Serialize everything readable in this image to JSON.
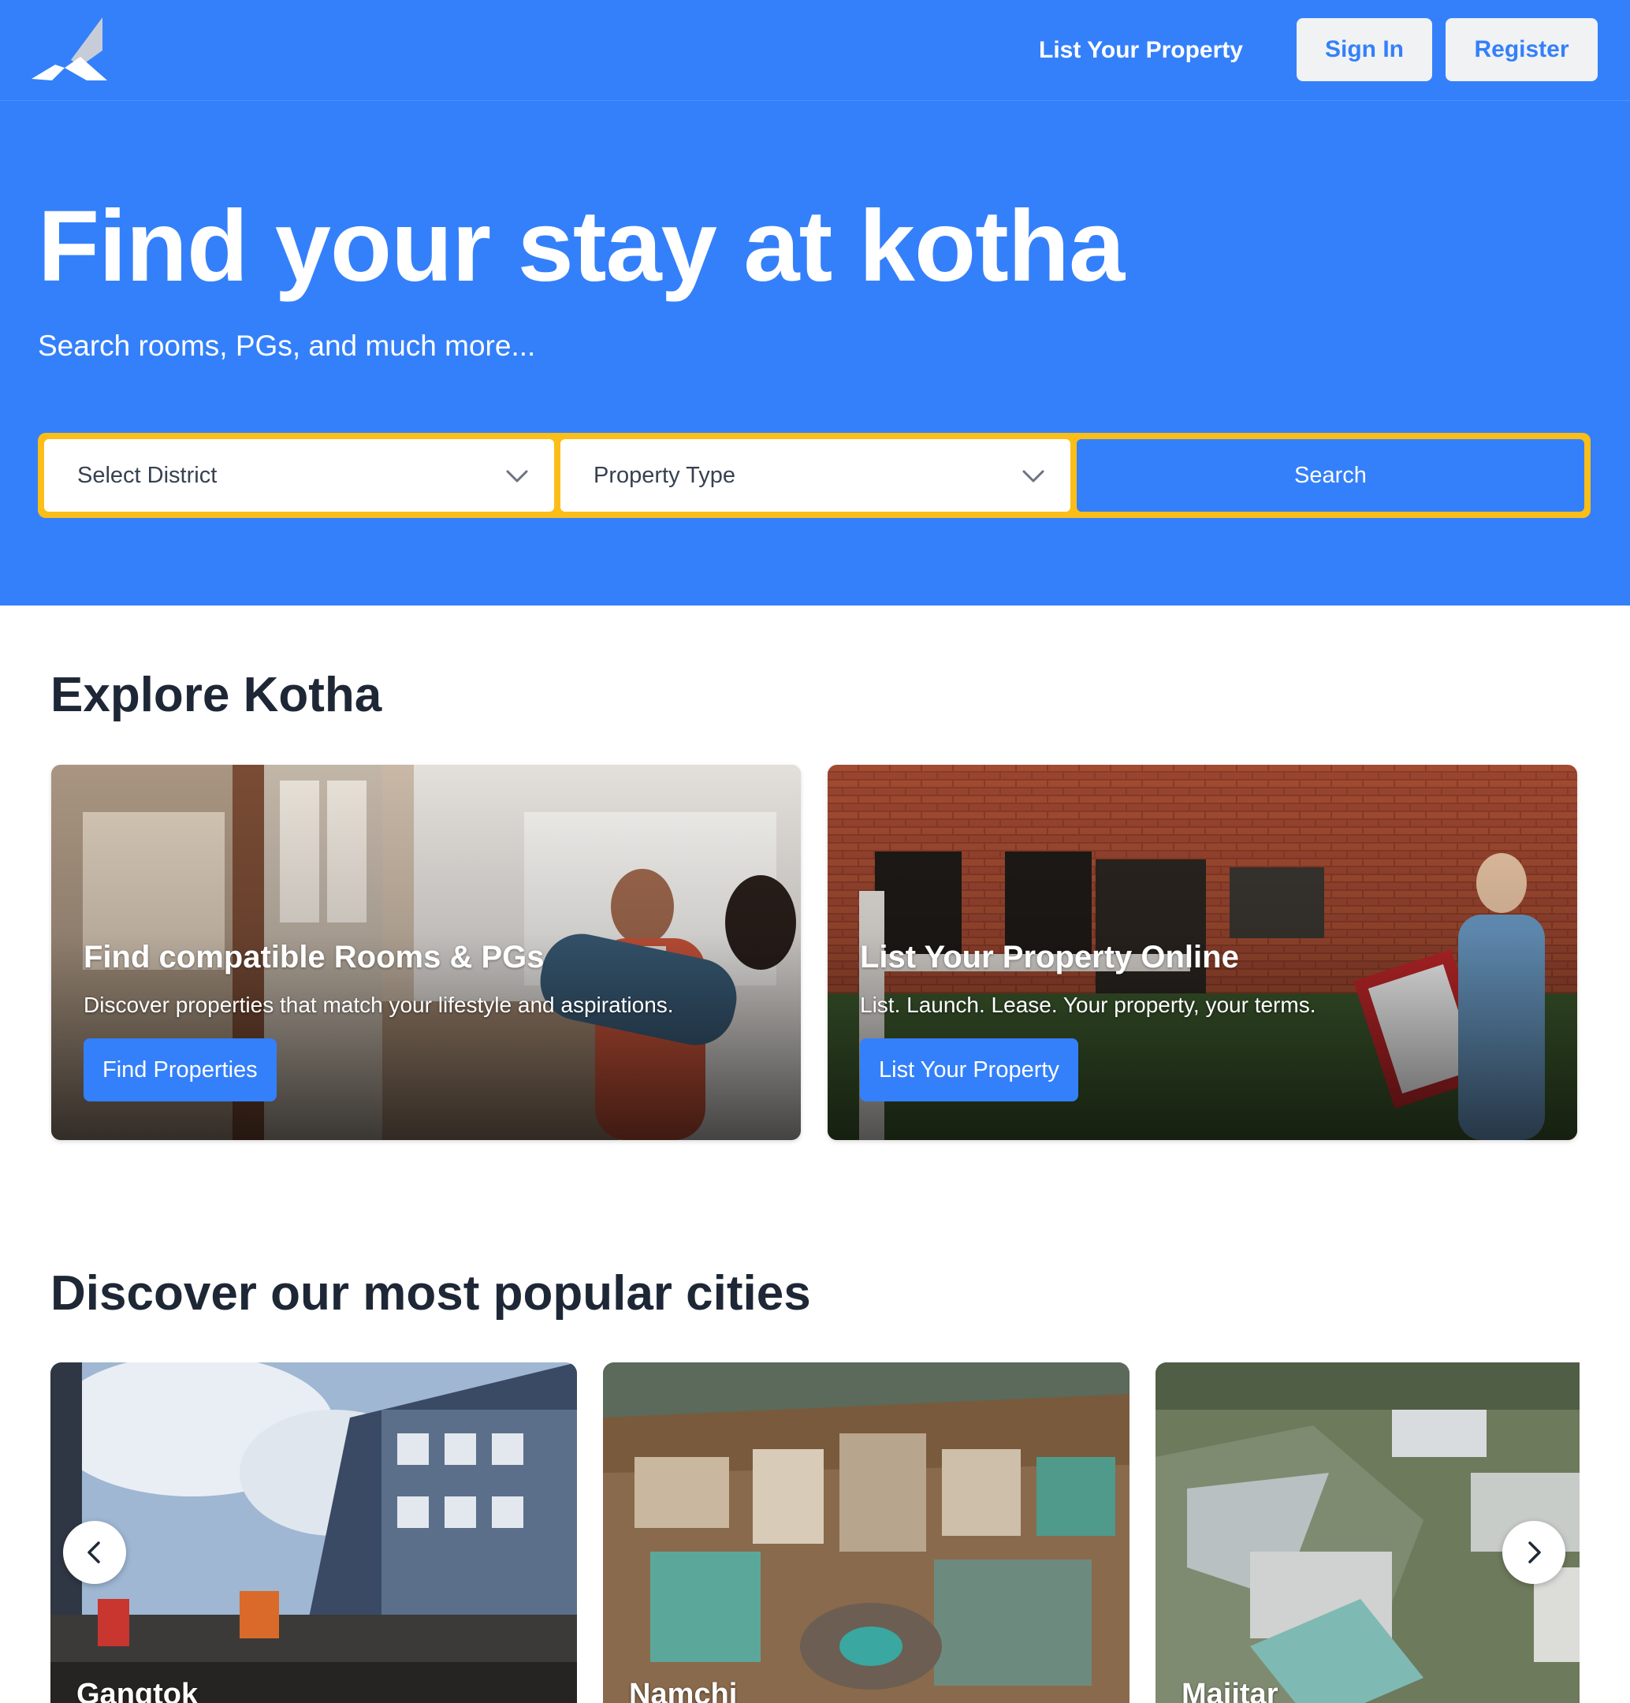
{
  "header": {
    "logo_icon": "kotha-logo-icon",
    "nav_link": "List Your Property",
    "sign_in": "Sign In",
    "register": "Register"
  },
  "hero": {
    "title": "Find your stay at kotha",
    "subtitle": "Search rooms, PGs, and much more...",
    "district_select": "Select District",
    "property_type_select": "Property Type",
    "search_button": "Search"
  },
  "explore": {
    "title": "Explore Kotha",
    "cards": [
      {
        "heading": "Find compatible Rooms & PGs",
        "description": "Discover properties that match your lifestyle and aspirations.",
        "button": "Find Properties"
      },
      {
        "heading": "List Your Property Online",
        "description": "List. Launch. Lease. Your property, your terms.",
        "button": "List Your Property"
      }
    ]
  },
  "cities": {
    "title": "Discover our most popular cities",
    "items": [
      {
        "name": "Gangtok"
      },
      {
        "name": "Namchi"
      },
      {
        "name": "Majitar"
      }
    ]
  },
  "colors": {
    "brand_blue": "#3480fa",
    "search_border": "#fbbd18",
    "heading_dark": "#1e2736"
  }
}
